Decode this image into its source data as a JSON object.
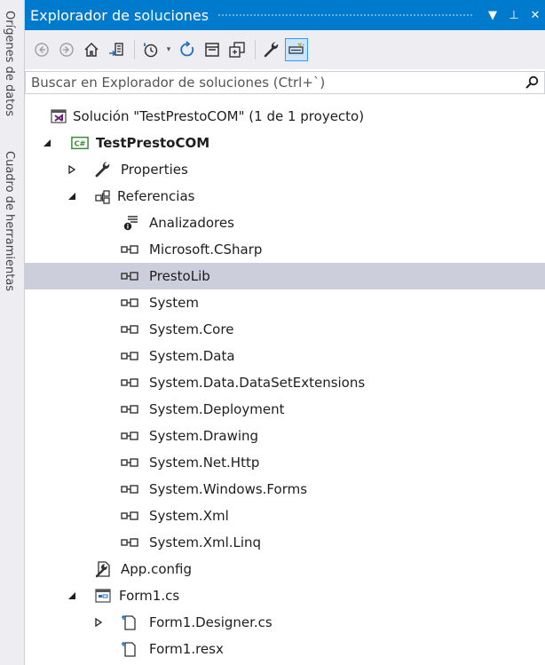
{
  "side_tabs": [
    "Orígenes de datos",
    "Cuadro de herramientas"
  ],
  "titlebar": {
    "title": "Explorador de soluciones",
    "buttons": [
      "▼",
      "⊥",
      "✕"
    ]
  },
  "toolbar": {
    "buttons": [
      "back-icon",
      "forward-icon",
      "home-icon",
      "switch-views-icon",
      "pending-changes-icon",
      "sync-icon",
      "collapse-all-icon",
      "show-all-files-icon",
      "properties-wrench-icon",
      "preview-selected-icon"
    ]
  },
  "search": {
    "placeholder": "Buscar en Explorador de soluciones (Ctrl+`)"
  },
  "tree": {
    "solution": "Solución \"TestPrestoCOM\"  (1 de 1 proyecto)",
    "project": "TestPrestoCOM",
    "properties": "Properties",
    "references": "Referencias",
    "analyzers": "Analizadores",
    "refs": [
      "Microsoft.CSharp",
      "PrestoLib",
      "System",
      "System.Core",
      "System.Data",
      "System.Data.DataSetExtensions",
      "System.Deployment",
      "System.Drawing",
      "System.Net.Http",
      "System.Windows.Forms",
      "System.Xml",
      "System.Xml.Linq"
    ],
    "selected_ref": "PrestoLib",
    "app_config": "App.config",
    "form1": "Form1.cs",
    "form1_designer": "Form1.Designer.cs",
    "form1_resx": "Form1.resx"
  },
  "colors": {
    "accent": "#007acc",
    "selection": "#cccedb",
    "csharp_green": "#388a34",
    "solution_purple": "#68217a"
  }
}
